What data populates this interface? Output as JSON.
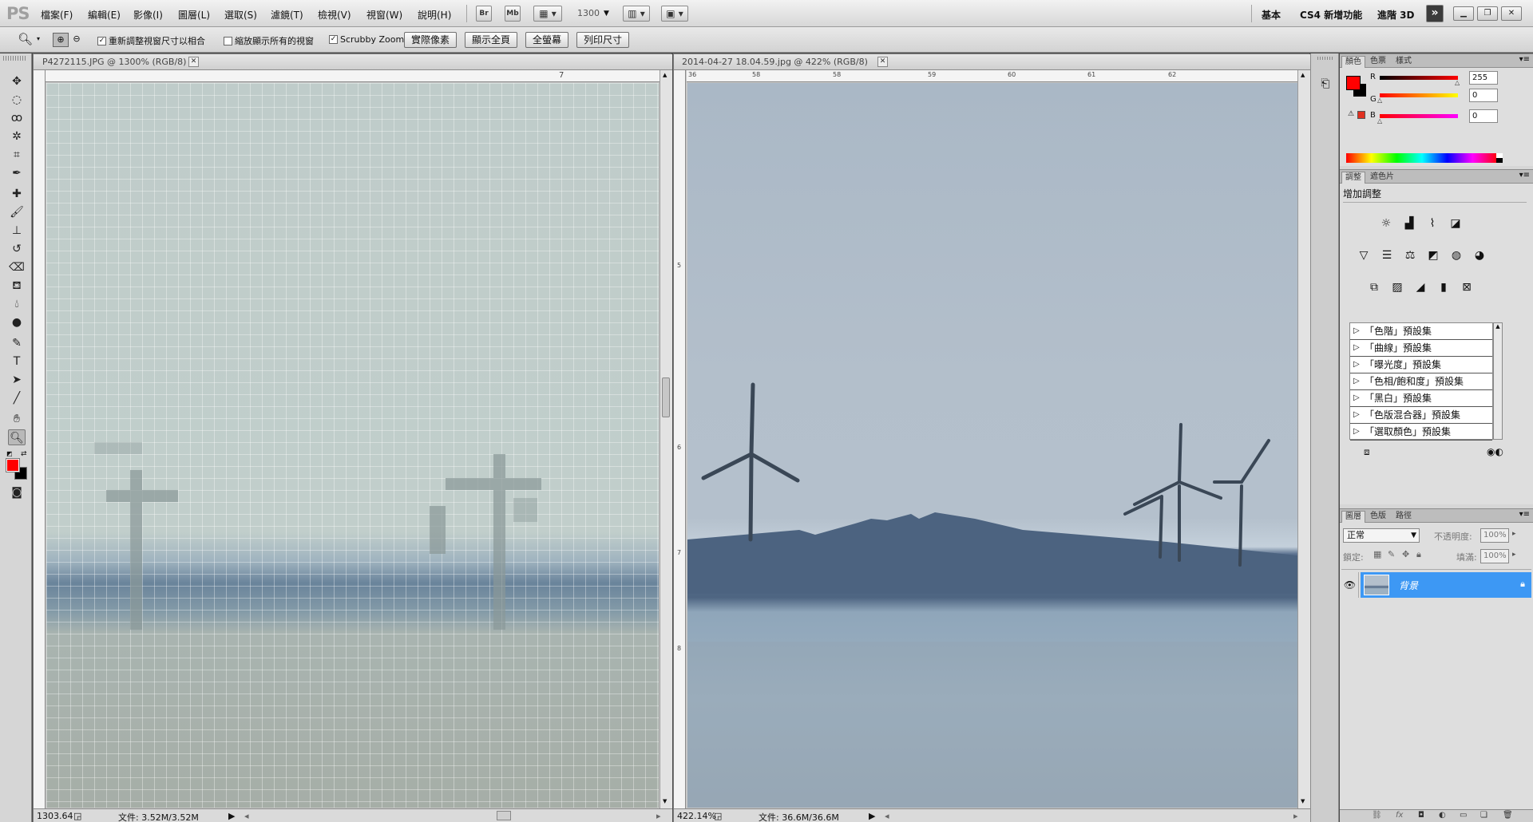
{
  "app": {
    "logo": "PS",
    "menu": [
      "檔案(F)",
      "編輯(E)",
      "影像(I)",
      "圖層(L)",
      "選取(S)",
      "濾鏡(T)",
      "檢視(V)",
      "視窗(W)",
      "說明(H)"
    ],
    "br_label": "Br",
    "mb_label": "Mb",
    "zoom_value": "1300",
    "workspaces": [
      "基本",
      "CS4 新增功能",
      "進階 3D"
    ],
    "more": "»"
  },
  "options": {
    "resize_windows": "重新調整視窗尺寸以相合",
    "zoom_all": "縮放顯示所有的視窗",
    "scrubby": "Scrubby Zoom",
    "btn_actual": "實際像素",
    "btn_fit": "顯示全頁",
    "btn_fill": "全螢幕",
    "btn_print": "列印尺寸"
  },
  "doc_left": {
    "title": "P4272115.JPG @ 1300% (RGB/8)",
    "ruler_mark": "7",
    "zoom": "1303.64",
    "file_info": "文件: 3.52M/3.52M"
  },
  "doc_right": {
    "title": "2014-04-27 18.04.59.jpg @ 422% (RGB/8)",
    "ruler_marks": [
      "36",
      "58",
      "58",
      "59",
      "60",
      "61",
      "62"
    ],
    "vruler_marks": [
      "5",
      "6",
      "7",
      "8"
    ],
    "zoom": "422.14%",
    "file_info": "文件: 36.6M/36.6M"
  },
  "color_panel": {
    "tabs": [
      "顏色",
      "色票",
      "樣式"
    ],
    "r_label": "R",
    "g_label": "G",
    "b_label": "B",
    "r": "255",
    "g": "0",
    "b": "0",
    "fg_color": "#ff0000",
    "bg_color": "#000000"
  },
  "adjust_panel": {
    "tabs": [
      "調整",
      "遮色片"
    ],
    "heading": "增加調整",
    "presets": [
      "「色階」預設集",
      "「曲線」預設集",
      "「曝光度」預設集",
      "「色相/飽和度」預設集",
      "「黑白」預設集",
      "「色版混合器」預設集",
      "「選取顏色」預設集"
    ]
  },
  "layers_panel": {
    "tabs": [
      "圖層",
      "色版",
      "路徑"
    ],
    "blend_mode": "正常",
    "opacity_label": "不透明度:",
    "opacity": "100%",
    "lock_label": "鎖定:",
    "fill_label": "填滿:",
    "fill": "100%",
    "layer_name": "背景"
  }
}
